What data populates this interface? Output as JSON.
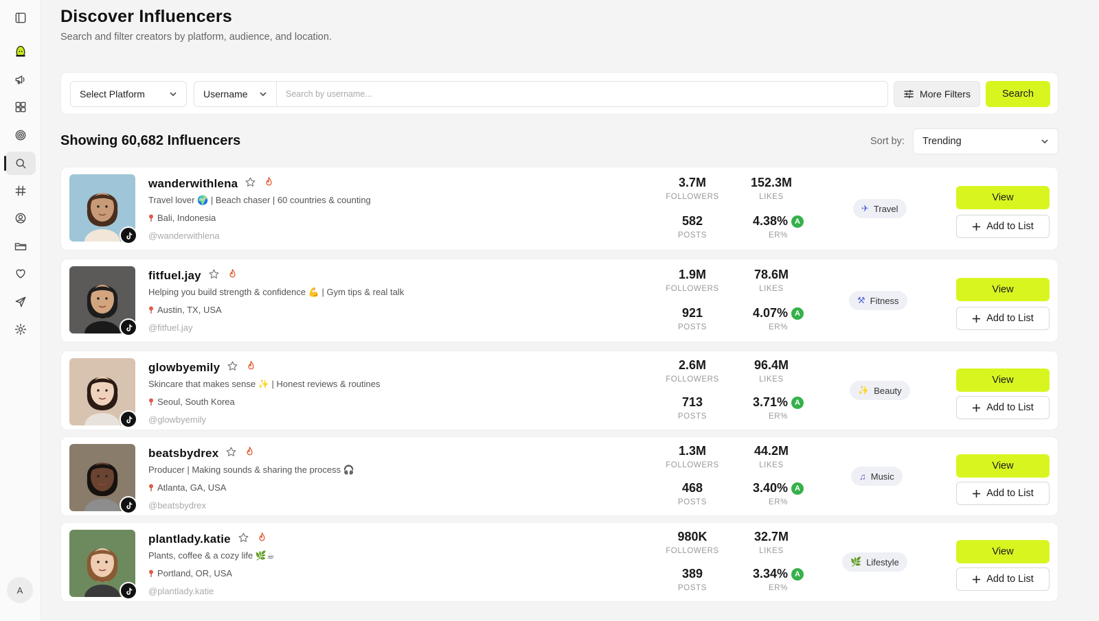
{
  "header": {
    "title": "Discover Influencers",
    "subtitle": "Search and filter creators by platform, audience, and location."
  },
  "search": {
    "platform_label": "Select Platform",
    "field_label": "Username",
    "placeholder": "Search by username...",
    "more_filters_label": "More Filters",
    "search_label": "Search"
  },
  "results": {
    "count_text": "Showing 60,682 Influencers",
    "sort_label": "Sort by:",
    "sort_value": "Trending"
  },
  "sidebar": {
    "items": [
      "sidebar-toggle",
      "logo",
      "campaigns",
      "dashboard",
      "targeting",
      "discover",
      "hashtags",
      "profile",
      "folders",
      "favorites",
      "send",
      "settings"
    ],
    "user_initial": "A"
  },
  "labels": {
    "followers": "FOLLOWERS",
    "likes": "LIKES",
    "posts": "POSTS",
    "er": "ER%",
    "view": "View",
    "add_to_list": "Add to List"
  },
  "influencers": [
    {
      "handle": "wanderwithlena",
      "bio": "Travel lover 🌍 | Beach chaser | 60 countries & counting",
      "location": "Bali, Indonesia",
      "at_handle": "@wanderwithlena",
      "followers": "3.7M",
      "likes": "152.3M",
      "posts": "582",
      "er": "4.38%",
      "grade": "A",
      "category": "Travel",
      "category_icon": "✈",
      "category_color": "#5b6cd8"
    },
    {
      "handle": "fitfuel.jay",
      "bio": "Helping you build strength & confidence 💪 | Gym tips & real talk",
      "location": "Austin, TX, USA",
      "at_handle": "@fitfuel.jay",
      "followers": "1.9M",
      "likes": "78.6M",
      "posts": "921",
      "er": "4.07%",
      "grade": "A",
      "category": "Fitness",
      "category_icon": "⚒",
      "category_color": "#5b6cd8"
    },
    {
      "handle": "glowbyemily",
      "bio": "Skincare that makes sense ✨ | Honest reviews & routines",
      "location": "Seoul, South Korea",
      "at_handle": "@glowbyemily",
      "followers": "2.6M",
      "likes": "96.4M",
      "posts": "713",
      "er": "3.71%",
      "grade": "A",
      "category": "Beauty",
      "category_icon": "✨",
      "category_color": "#e0a800"
    },
    {
      "handle": "beatsbydrex",
      "bio": "Producer | Making sounds & sharing the process 🎧",
      "location": "Atlanta, GA, USA",
      "at_handle": "@beatsbydrex",
      "followers": "1.3M",
      "likes": "44.2M",
      "posts": "468",
      "er": "3.40%",
      "grade": "A",
      "category": "Music",
      "category_icon": "♫",
      "category_color": "#6a4fd0"
    },
    {
      "handle": "plantlady.katie",
      "bio": "Plants, coffee & a cozy life 🌿☕",
      "location": "Portland, OR, USA",
      "at_handle": "@plantlady.katie",
      "followers": "980K",
      "likes": "32.7M",
      "posts": "389",
      "er": "3.34%",
      "grade": "A",
      "category": "Lifestyle",
      "category_icon": "🌿",
      "category_color": "#3aa64a"
    }
  ]
}
